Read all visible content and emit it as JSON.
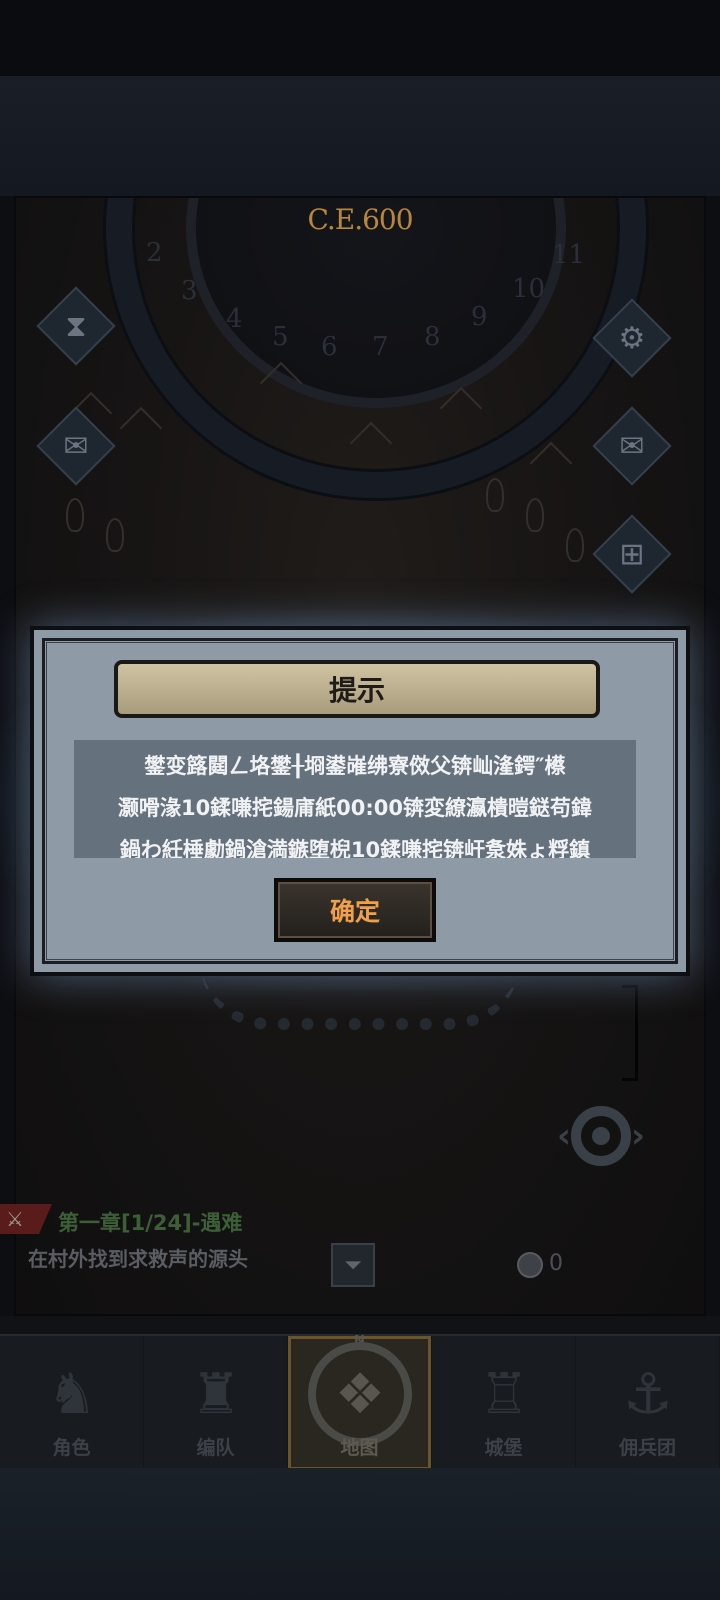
{
  "era": "C.E.600",
  "dial_numbers": [
    "2",
    "3",
    "4",
    "5",
    "6",
    "7",
    "8",
    "9",
    "10",
    "11"
  ],
  "quest": {
    "title": "第一章[1/24]-遇难",
    "description": "在村外找到求救声的源头"
  },
  "coins": "0",
  "nav": {
    "items": [
      {
        "label": "角色",
        "icon": "knight-icon"
      },
      {
        "label": "编队",
        "icon": "helmet-icon"
      },
      {
        "label": "地图",
        "icon": "compass-map-icon",
        "marker": "N"
      },
      {
        "label": "城堡",
        "icon": "castle-icon"
      },
      {
        "label": "佣兵团",
        "icon": "ship-icon"
      }
    ],
    "active_index": 2
  },
  "dialog": {
    "title": "提示",
    "lines": [
      "鐢变簬閮ㄥ垎鐢╂埛鍙嶉绋寮傚父锛屾湰鍔″櫒",
      "灏嗗湪10鍒嗛挓鍚庯紙00:00锛変繚瀛樻暟鎹苟鍏",
      "鍋わ紝棰勮鍋滄満鏃堕棿10鍒嗛挓锛屽洜姝ょ粰鎮"
    ],
    "ok_label": "确定"
  },
  "colors": {
    "dialog_bg": "#8e9aa6",
    "ok_text": "#f0a04a",
    "era_text": "#b9873b",
    "quest_title": "#3d5f37"
  }
}
